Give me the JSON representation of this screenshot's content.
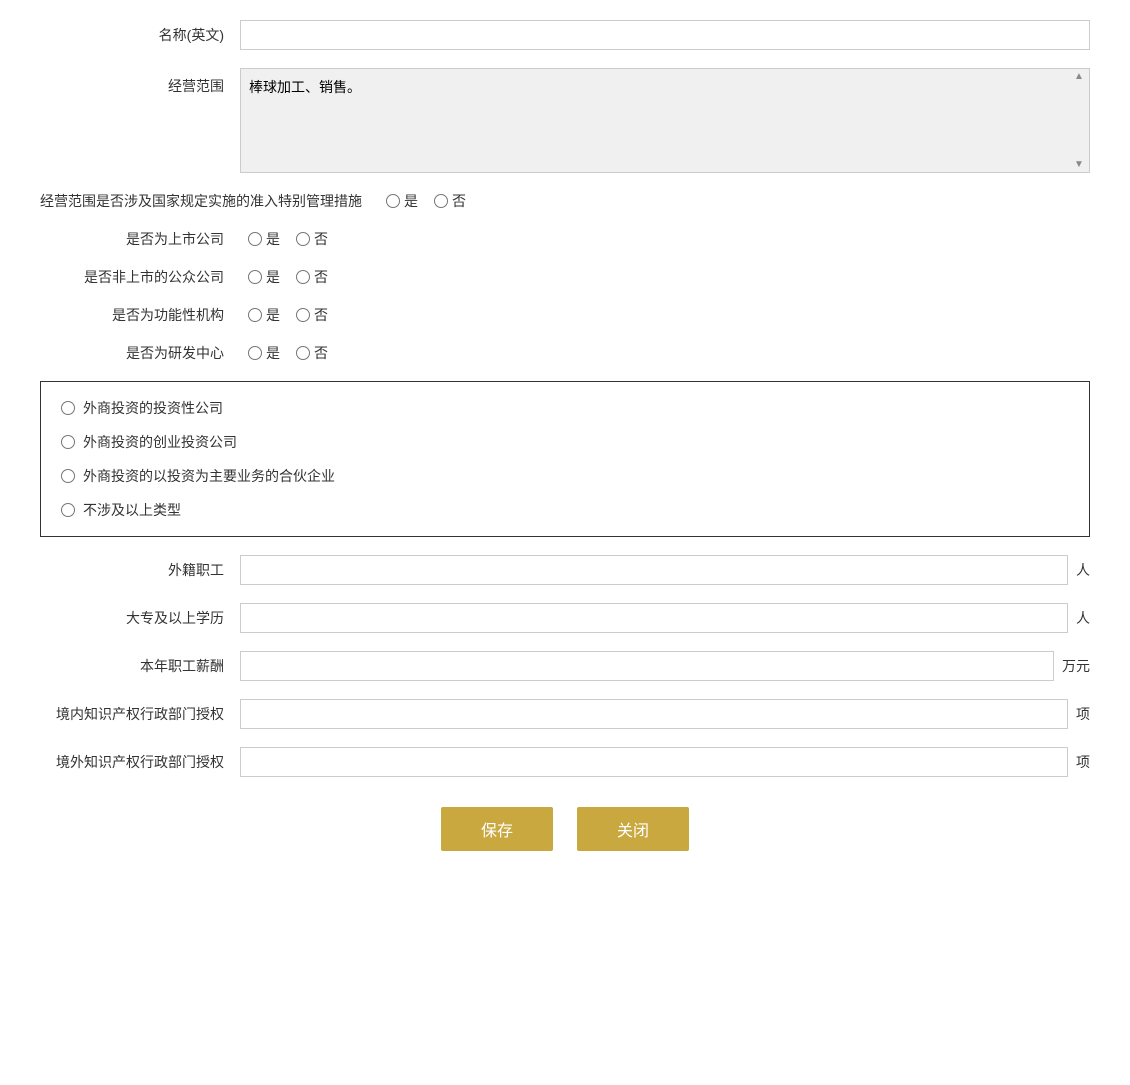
{
  "form": {
    "name_en_label": "名称(英文)",
    "name_en_placeholder": "",
    "scope_label": "经营范围",
    "scope_value": "棒球加工、销售。",
    "scope_special_label": "经营范围是否涉及国家规定实施的准入特别管理措施",
    "yes_label": "是",
    "no_label": "否",
    "listed_label": "是否为上市公司",
    "public_unlisted_label": "是否非上市的公众公司",
    "functional_label": "是否为功能性机构",
    "rd_label": "是否为研发中心",
    "checkbox_options": [
      "外商投资的投资性公司",
      "外商投资的创业投资公司",
      "外商投资的以投资为主要业务的合伙企业",
      "不涉及以上类型"
    ],
    "foreign_staff_label": "外籍职工",
    "foreign_staff_unit": "人",
    "education_label": "大专及以上学历",
    "education_unit": "人",
    "salary_label": "本年职工薪酬",
    "salary_unit": "万元",
    "domestic_ip_label": "境内知识产权行政部门授权",
    "domestic_ip_unit": "项",
    "foreign_ip_label": "境外知识产权行政部门授权",
    "foreign_ip_unit": "项",
    "save_label": "保存",
    "close_label": "关闭"
  }
}
